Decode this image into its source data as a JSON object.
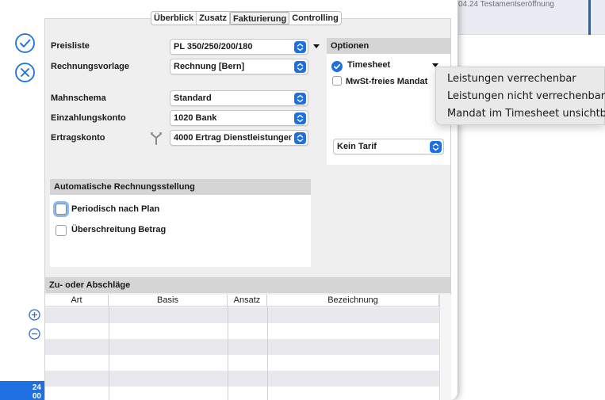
{
  "background_window": {
    "title_text": "04.24 Testamentseröffnung"
  },
  "side_actions": {
    "confirm_icon": "checkmark-circle-icon",
    "cancel_icon": "x-circle-icon"
  },
  "tabs": [
    {
      "label": "Überblick",
      "active": false
    },
    {
      "label": "Zusatz",
      "active": false
    },
    {
      "label": "Fakturierung",
      "active": true
    },
    {
      "label": "Controlling",
      "active": false
    }
  ],
  "billing": {
    "preisliste_label": "Preisliste",
    "preisliste_value": "PL 350/250/200/180",
    "rechnungsvorlage_label": "Rechnungsvorlage",
    "rechnungsvorlage_value": "Rechnung [Bern]",
    "mahnschema_label": "Mahnschema",
    "mahnschema_value": "Standard",
    "einzahlungskonto_label": "Einzahlungskonto",
    "einzahlungskonto_value": "1020 Bank",
    "ertragskonto_label": "Ertragskonto",
    "ertragskonto_value": "4000 Ertrag Dienstleistungen"
  },
  "options": {
    "title": "Optionen",
    "timesheet_label": "Timesheet",
    "timesheet_checked": true,
    "mwst_label": "MwSt-freies Mandat",
    "mwst_checked": false,
    "tarif_value": "Kein Tarif"
  },
  "timesheet_menu": {
    "items": [
      "Leistungen verrechenbar",
      "Leistungen nicht verrechenbar",
      "Mandat im Timesheet unsichtbar"
    ]
  },
  "auto_billing": {
    "title": "Automatische Rechnungsstellung",
    "periodic_label": "Periodisch nach Plan",
    "periodic_checked": false,
    "exceed_label": "Überschreitung Betrag",
    "exceed_checked": false
  },
  "surcharges": {
    "title": "Zu- oder Abschläge",
    "columns": [
      "Art",
      "Basis",
      "Ansatz",
      "Bezeichnung"
    ],
    "rows": []
  },
  "date_badge": {
    "line1": "24",
    "line2": "00"
  },
  "colors": {
    "accent": "#1e6fe0",
    "panel": "#efefef",
    "header": "#d5d5d5"
  }
}
